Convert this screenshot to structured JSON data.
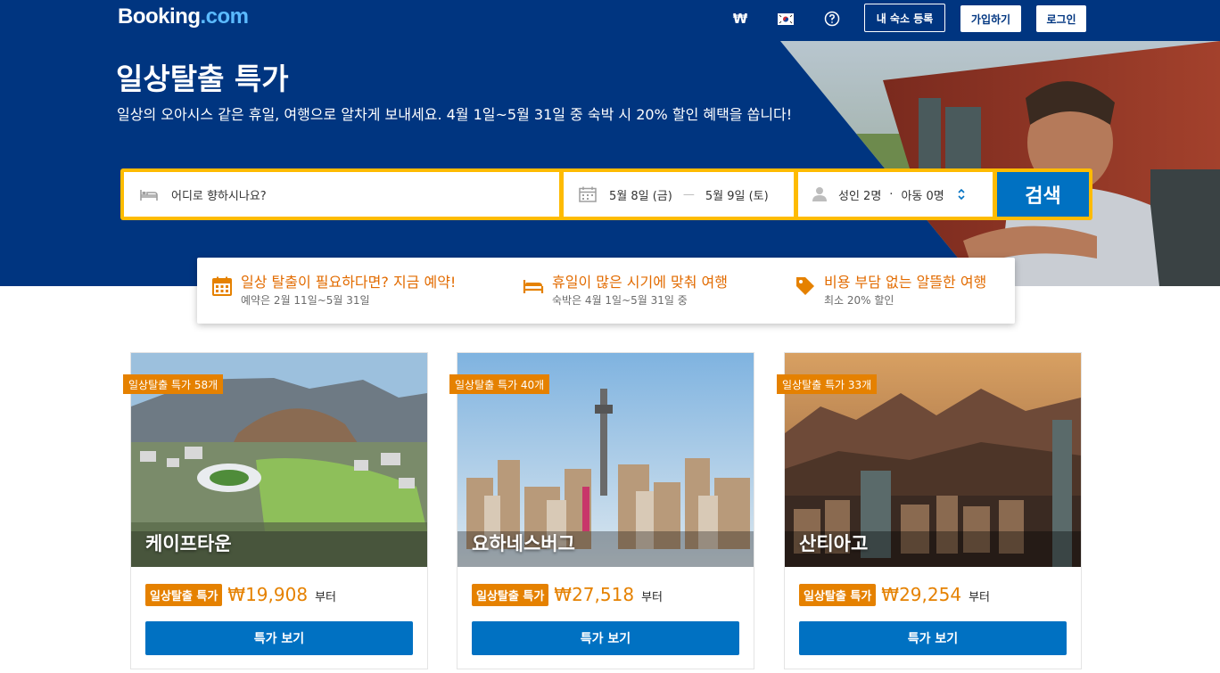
{
  "header": {
    "logo_main": "Booking",
    "logo_suffix": ".com",
    "currency": "₩",
    "language_icon": "korea-flag-icon",
    "help_icon": "help-circle-icon",
    "list_property": "내 숙소 등록",
    "register": "가입하기",
    "sign_in": "로그인"
  },
  "hero": {
    "title": "일상탈출 특가",
    "subtitle": "일상의 오아시스 같은 휴일, 여행으로 알차게 보내세요. 4월 1일~5월 31일 중 숙박 시 20% 할인 혜택을 쏩니다!"
  },
  "search": {
    "destination_placeholder": "어디로 향하시나요?",
    "checkin": "5월 8일 (금)",
    "date_separator": "—",
    "checkout": "5월 9일 (토)",
    "adults": "성인 2명",
    "guest_separator": "·",
    "children": "아동 0명",
    "search_button": "검색"
  },
  "features": [
    {
      "icon": "calendar-icon",
      "title": "일상 탈출이 필요하다면? 지금 예약!",
      "subtitle": "예약은 2월 11일~5월 31일"
    },
    {
      "icon": "bed-icon",
      "title": "휴일이 많은 시기에 맞춰 여행",
      "subtitle": "숙박은 4월 1일~5월 31일 중"
    },
    {
      "icon": "price-tag-icon",
      "title": "비용 부담 없는 알뜰한 여행",
      "subtitle": "최소 20% 할인"
    }
  ],
  "cards": [
    {
      "badge": "일상탈출 특가 58개",
      "city": "케이프타운",
      "deal_label": "일상탈출 특가",
      "price": "₩19,908",
      "price_suffix": "부터",
      "button": "특가 보기"
    },
    {
      "badge": "일상탈출 특가 40개",
      "city": "요하네스버그",
      "deal_label": "일상탈출 특가",
      "price": "₩27,518",
      "price_suffix": "부터",
      "button": "특가 보기"
    },
    {
      "badge": "일상탈출 특가 33개",
      "city": "산티아고",
      "deal_label": "일상탈출 특가",
      "price": "₩29,254",
      "price_suffix": "부터",
      "button": "특가 보기"
    }
  ],
  "colors": {
    "brand_blue": "#003580",
    "action_blue": "#0071c2",
    "search_yellow": "#febb02",
    "deal_orange": "#e58100"
  }
}
